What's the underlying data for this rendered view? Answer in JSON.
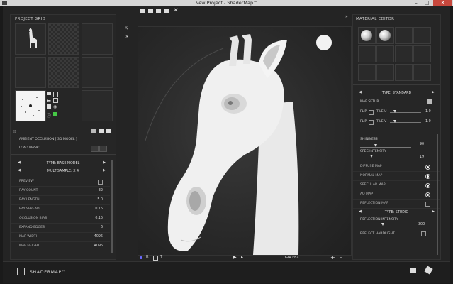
{
  "window": {
    "title": "New Project - ShaderMap™",
    "minimize": "–",
    "maximize": "□",
    "close": "✕"
  },
  "left": {
    "project_grid_label": "PROJECT GRID",
    "map_title": "AMBIENT OCCLUSION [ 3D MODEL ]",
    "load_mask_label": "LOAD MASK:",
    "type_selector": "TYPE: BASE MODEL",
    "multisample": "MULTISAMPLE: X 4",
    "props": [
      {
        "label": "PREVIEW",
        "value": ""
      },
      {
        "label": "RAY COUNT",
        "value": "32"
      },
      {
        "label": "RAY LENGTH",
        "value": "5.0"
      },
      {
        "label": "RAY SPREAD",
        "value": "0.15"
      },
      {
        "label": "OCCLUSION BIAS",
        "value": "0.15"
      },
      {
        "label": "EXPAND EDGES",
        "value": "6"
      },
      {
        "label": "MAP WIDTH",
        "value": "4096"
      },
      {
        "label": "MAP HEIGHT",
        "value": "4096"
      }
    ]
  },
  "viewport": {
    "status_text": "GIR.FBX"
  },
  "right": {
    "material_editor_label": "MATERIAL EDITOR",
    "type_selector": "TYPE: STANDARD",
    "map_setup_label": "MAP SETUP",
    "flip_u": {
      "flip": "FLIP",
      "tile": "TILE U",
      "value": "1.0"
    },
    "flip_v": {
      "flip": "FLIP",
      "tile": "TILE V",
      "value": "1.0"
    },
    "shininess_label": "SHININESS",
    "shininess_value": "90",
    "spec_intensity_label": "SPEC INTENSITY",
    "spec_intensity_value": "19",
    "maps": [
      {
        "label": "DIFFUSE MAP",
        "on": true
      },
      {
        "label": "NORMAL MAP",
        "on": true
      },
      {
        "label": "SPECULAR MAP",
        "on": true
      },
      {
        "label": "AO MAP",
        "on": true
      },
      {
        "label": "REFLECTION MAP",
        "on": false
      }
    ],
    "studio_selector": "TYPE: STUDIO",
    "reflection_intensity_label": "REFLECTION INTENSITY",
    "reflection_intensity_value": "300",
    "reflect_hardlight_label": "REFLECT HARDLIGHT"
  },
  "bottom": {
    "logo": "SHADERMAP™"
  },
  "colors": {
    "accent": "#46c946",
    "close_btn": "#c7483d",
    "bg": "#242424"
  }
}
